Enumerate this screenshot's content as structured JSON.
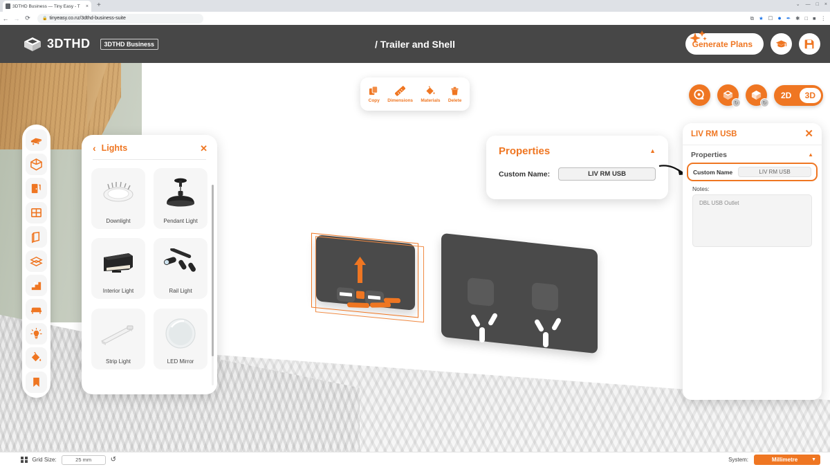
{
  "browser": {
    "tab_title": "3DTHD Business — Tiny Easy - T",
    "tab_close": "×",
    "new_tab": "+",
    "back": "←",
    "forward": "→",
    "reload": "⟳",
    "lock": "🔒",
    "url": "tinyeasy.co.nz/3dthd-business-suite",
    "ext_icons": [
      "share-icon",
      "bookmark-star-icon",
      "camera-icon",
      "circle-blue-icon",
      "pen-icon",
      "puzzle-icon",
      "square-icon",
      "profile-icon",
      "menu-icon"
    ],
    "win_minimize": "—",
    "win_maximize": "□",
    "win_close": "×",
    "win_chevron": "⌄"
  },
  "header": {
    "logo_text": "3DTHD",
    "logo_badge": "3DTHD Business",
    "title": "/ Trailer and Shell",
    "generate_label": "Generate Plans",
    "tutorial_icon": "graduation-cap-icon",
    "save_icon": "save-disk-icon"
  },
  "toolrail": {
    "items": [
      {
        "name": "trailer-base",
        "icon": "trailer-icon"
      },
      {
        "name": "shell",
        "icon": "cube-shell-icon"
      },
      {
        "name": "doors",
        "icon": "door-icon"
      },
      {
        "name": "windows",
        "icon": "window-icon"
      },
      {
        "name": "walls",
        "icon": "wall-panel-icon"
      },
      {
        "name": "floors",
        "icon": "layers-icon"
      },
      {
        "name": "stairs",
        "icon": "stairs-icon"
      },
      {
        "name": "furniture",
        "icon": "sofa-icon"
      },
      {
        "name": "lights",
        "icon": "lightbulb-icon"
      },
      {
        "name": "materials",
        "icon": "paint-bucket-icon"
      },
      {
        "name": "bookmarks",
        "icon": "bookmark-icon"
      }
    ]
  },
  "lights_panel": {
    "back": "‹",
    "title": "Lights",
    "close": "✕",
    "items": [
      {
        "label": "Downlight",
        "icon": "downlight-thumb"
      },
      {
        "label": "Pendant Light",
        "icon": "pendant-light-thumb"
      },
      {
        "label": "Interior Light",
        "icon": "interior-light-thumb"
      },
      {
        "label": "Rail Light",
        "icon": "rail-light-thumb"
      },
      {
        "label": "Strip Light",
        "icon": "strip-light-thumb"
      },
      {
        "label": "LED Mirror",
        "icon": "led-mirror-thumb"
      }
    ]
  },
  "context_toolbar": {
    "items": [
      {
        "label": "Copy",
        "icon": "copy-icon"
      },
      {
        "label": "Dimensions",
        "icon": "ruler-icon"
      },
      {
        "label": "Materials",
        "icon": "paint-bucket-icon"
      },
      {
        "label": "Delete",
        "icon": "trash-icon"
      }
    ]
  },
  "view_controls": {
    "buttons": [
      {
        "name": "measure-tape-button",
        "icon": "tape-measure-icon",
        "badge": ""
      },
      {
        "name": "top-view-button",
        "icon": "box-top-view-icon",
        "badge": "↻"
      },
      {
        "name": "iso-view-button",
        "icon": "box-iso-view-icon",
        "badge": "↻"
      }
    ],
    "toggle_2d": "2D",
    "toggle_3d": "3D",
    "active": "3D"
  },
  "properties_callout": {
    "title": "Properties",
    "caret": "▲",
    "custom_name_label": "Custom Name:",
    "custom_name_value": "LIV RM USB"
  },
  "right_panel": {
    "title": "LIV RM USB",
    "close": "✕",
    "section_title": "Properties",
    "caret": "▲",
    "custom_name_label": "Custom Name",
    "custom_name_value": "LIV RM USB",
    "notes_label": "Notes:",
    "notes_value": "DBL USB Outlet"
  },
  "bottom_bar": {
    "grid_icon": "grid-icon",
    "grid_label": "Grid Size:",
    "grid_value": "25 mm",
    "reset_icon": "↺",
    "system_label": "System:",
    "system_value": "Millimetre",
    "system_caret": "▼"
  },
  "colors": {
    "accent": "#ef7622",
    "header_bg": "#474747",
    "outlet": "#4a4a4a"
  }
}
